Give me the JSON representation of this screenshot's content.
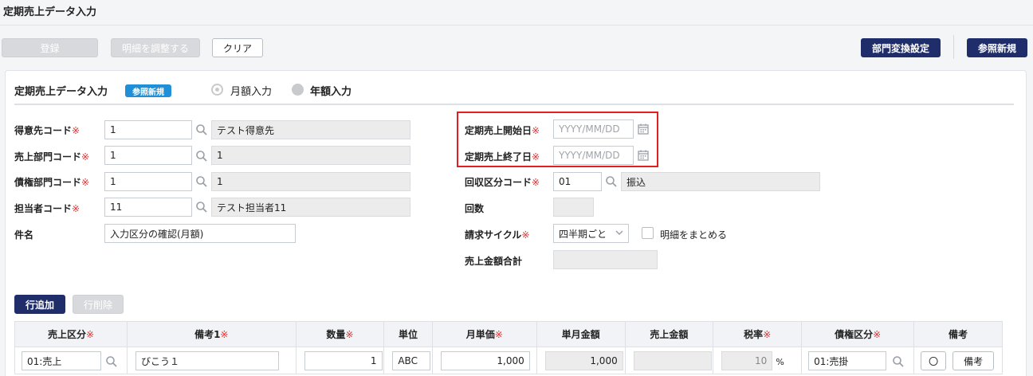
{
  "page": {
    "title": "定期売上データ入力"
  },
  "toolbar": {
    "register": "登録",
    "adjust": "明細を調整する",
    "clear": "クリア",
    "dept_settings": "部門変換設定",
    "ref_new": "参照新規"
  },
  "section": {
    "title": "定期売上データ入力",
    "badge": "参照新規",
    "radio_monthly": "月額入力",
    "radio_annual": "年額入力"
  },
  "required_mark": "※",
  "form_left": {
    "customer_code": {
      "label": "得意先コード",
      "value": "1",
      "name": "テスト得意先"
    },
    "sales_dept_code": {
      "label": "売上部門コード",
      "value": "1",
      "name": "1"
    },
    "claim_dept_code": {
      "label": "債権部門コード",
      "value": "1",
      "name": "1"
    },
    "staff_code": {
      "label": "担当者コード",
      "value": "11",
      "name": "テスト担当者11"
    },
    "subject": {
      "label": "件名",
      "value": "入力区分の確認(月額)"
    }
  },
  "form_right": {
    "start_date": {
      "label": "定期売上開始日",
      "placeholder": "YYYY/MM/DD"
    },
    "end_date": {
      "label": "定期売上終了日",
      "placeholder": "YYYY/MM/DD"
    },
    "collection_code": {
      "label": "回収区分コード",
      "value": "01",
      "name": "振込"
    },
    "count": {
      "label": "回数",
      "value": ""
    },
    "billing_cycle": {
      "label": "請求サイクル",
      "value": "四半期ごと",
      "checkbox_label": "明細をまとめる"
    },
    "sales_total": {
      "label": "売上金額合計",
      "value": ""
    }
  },
  "grid_actions": {
    "add_row": "行追加",
    "delete_row": "行削除"
  },
  "table": {
    "headers": [
      "売上区分",
      "備考1",
      "数量",
      "単位",
      "月単価",
      "単月金額",
      "売上金額",
      "税率",
      "債権区分",
      "備考"
    ],
    "required": [
      true,
      true,
      true,
      false,
      true,
      false,
      false,
      true,
      true,
      false
    ],
    "row": {
      "sales_type": "01:売上",
      "note1": "びこう１",
      "quantity": "1",
      "unit": "ABC",
      "unit_price": "1,000",
      "monthly_amount": "1,000",
      "sales_amount": "",
      "tax_rate": "10",
      "tax_unit": "%",
      "claim_type": "01:売掛",
      "circle": "〇",
      "note_button": "備考"
    }
  }
}
